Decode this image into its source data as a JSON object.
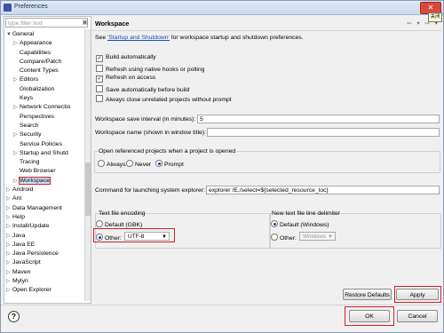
{
  "window": {
    "title": "Preferences",
    "close_glyph": "✕",
    "tooltip_close": "关闭"
  },
  "filter": {
    "placeholder": "type filter text"
  },
  "tree": [
    {
      "label": "General",
      "level": 0,
      "twisty": "▼"
    },
    {
      "label": "Appearance",
      "level": 1,
      "twisty": "▷"
    },
    {
      "label": "Capabilities",
      "level": 1,
      "twisty": ""
    },
    {
      "label": "Compare/Patch",
      "level": 1,
      "twisty": ""
    },
    {
      "label": "Content Types",
      "level": 1,
      "twisty": ""
    },
    {
      "label": "Editors",
      "level": 1,
      "twisty": "▷"
    },
    {
      "label": "Globalization",
      "level": 1,
      "twisty": ""
    },
    {
      "label": "Keys",
      "level": 1,
      "twisty": ""
    },
    {
      "label": "Network Connectio",
      "level": 1,
      "twisty": "▷"
    },
    {
      "label": "Perspectives",
      "level": 1,
      "twisty": ""
    },
    {
      "label": "Search",
      "level": 1,
      "twisty": ""
    },
    {
      "label": "Security",
      "level": 1,
      "twisty": "▷"
    },
    {
      "label": "Service Policies",
      "level": 1,
      "twisty": ""
    },
    {
      "label": "Startup and Shutd",
      "level": 1,
      "twisty": "▷"
    },
    {
      "label": "Tracing",
      "level": 1,
      "twisty": ""
    },
    {
      "label": "Web Browser",
      "level": 1,
      "twisty": ""
    },
    {
      "label": "Workspace",
      "level": 1,
      "twisty": "▷",
      "selected": true
    },
    {
      "label": "Android",
      "level": 0,
      "twisty": "▷"
    },
    {
      "label": "Ant",
      "level": 0,
      "twisty": "▷"
    },
    {
      "label": "Data Management",
      "level": 0,
      "twisty": "▷"
    },
    {
      "label": "Help",
      "level": 0,
      "twisty": "▷"
    },
    {
      "label": "Install/Update",
      "level": 0,
      "twisty": "▷"
    },
    {
      "label": "Java",
      "level": 0,
      "twisty": "▷"
    },
    {
      "label": "Java EE",
      "level": 0,
      "twisty": "▷"
    },
    {
      "label": "Java Persistence",
      "level": 0,
      "twisty": "▷"
    },
    {
      "label": "JavaScript",
      "level": 0,
      "twisty": "▷"
    },
    {
      "label": "Maven",
      "level": 0,
      "twisty": "▷"
    },
    {
      "label": "Mylyn",
      "level": 0,
      "twisty": "▷"
    },
    {
      "label": "Open Explorer",
      "level": 0,
      "twisty": "▷"
    }
  ],
  "page": {
    "title": "Workspace",
    "nav_icons": "⇦ ▾ ⇨ ▾",
    "desc_prefix": "See ",
    "desc_link": "'Startup and Shutdown'",
    "desc_suffix": " for workspace startup and shutdown preferences.",
    "options": [
      {
        "label": "Build automatically",
        "checked": true
      },
      {
        "label": "Refresh using native hooks or polling",
        "checked": false
      },
      {
        "label": "Refresh on access",
        "checked": true
      },
      {
        "label": "Save automatically before build",
        "checked": false
      },
      {
        "label": "Always close unrelated projects without prompt",
        "checked": false
      }
    ],
    "save_interval_label": "Workspace save interval (in minutes):",
    "save_interval_value": "5",
    "workspace_name_label": "Workspace name (shown in window title):",
    "workspace_name_value": "",
    "open_ref_title": "Open referenced projects when a project is opened",
    "open_ref": [
      "Always",
      "Never",
      "Prompt"
    ],
    "open_ref_selected": "Prompt",
    "explorer_label": "Command for launching system explorer:",
    "explorer_value": "explorer /E,/select=${selected_resource_loc}",
    "encoding_title": "Text file encoding",
    "encoding_default": "Default (GBK)",
    "encoding_other": "Other:",
    "encoding_value": "UTF-8",
    "delim_title": "New text file line delimiter",
    "delim_default": "Default (Windows)",
    "delim_other": "Other:",
    "delim_value": "Windows"
  },
  "buttons": {
    "restore": "Restore Defaults",
    "apply": "Apply",
    "ok": "OK",
    "cancel": "Cancel",
    "help": "?"
  },
  "colors": {
    "highlight": "#d21f2b",
    "link": "#1a4cb3",
    "selection": "#cfe3f7"
  }
}
